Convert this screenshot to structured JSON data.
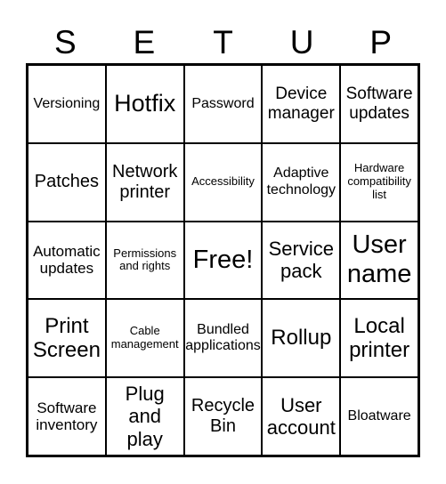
{
  "header": {
    "letters": [
      "S",
      "E",
      "T",
      "U",
      "P"
    ]
  },
  "board": {
    "cells": [
      "Versioning",
      "Hotfix",
      "Password",
      "Device manager",
      "Software updates",
      "Patches",
      "Network printer",
      "Accessibility",
      "Adaptive technology",
      "Hardware compatibility list",
      "Automatic updates",
      "Permissions and rights",
      "Free!",
      "Service pack",
      "User name",
      "Print Screen",
      "Cable management",
      "Bundled applications",
      "Rollup",
      "Local printer",
      "Software inventory",
      "Plug and play",
      "Recycle Bin",
      "User account",
      "Bloatware"
    ]
  }
}
